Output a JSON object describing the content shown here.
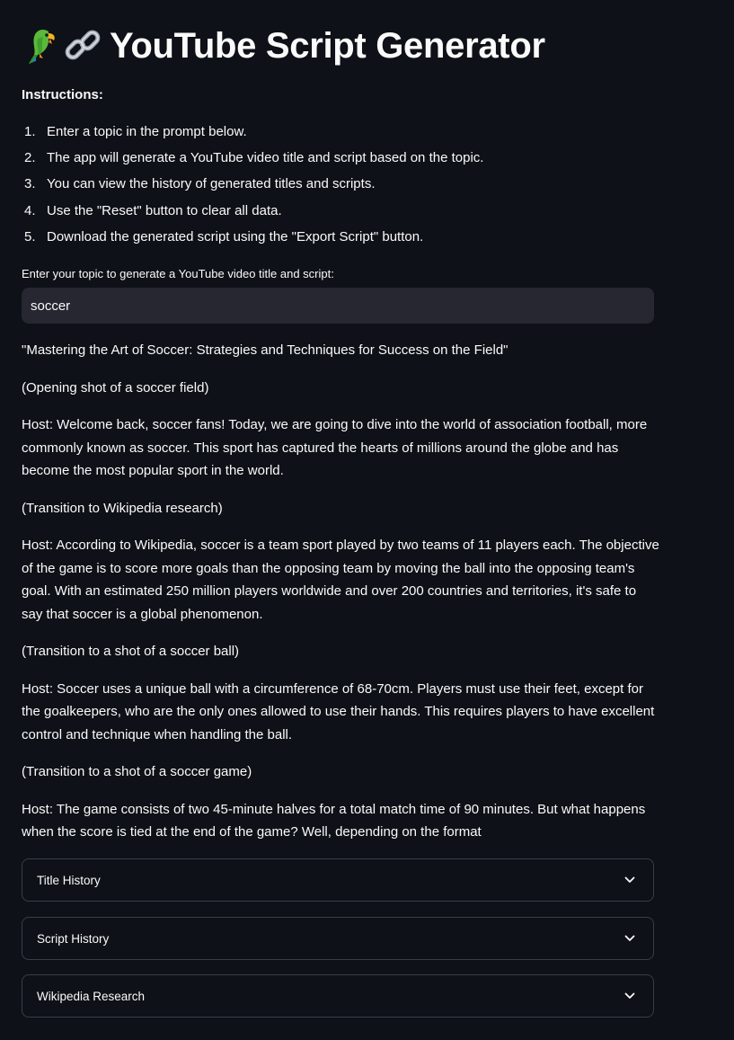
{
  "header": {
    "title": "YouTube Script Generator",
    "icons": [
      "parrot-emoji",
      "link-emoji"
    ]
  },
  "instructions": {
    "label": "Instructions:",
    "steps": [
      {
        "num": "1.",
        "text": "Enter a topic in the prompt below."
      },
      {
        "num": "2.",
        "text": "The app will generate a YouTube video title and script based on the topic."
      },
      {
        "num": "3.",
        "text": "You can view the history of generated titles and scripts."
      },
      {
        "num": "4.",
        "text": "Use the \"Reset\" button to clear all data."
      },
      {
        "num": "5.",
        "text": "Download the generated script using the \"Export Script\" button."
      }
    ]
  },
  "topic_input": {
    "label": "Enter your topic to generate a YouTube video title and script:",
    "value": "soccer"
  },
  "script": {
    "paragraphs": [
      "\"Mastering the Art of Soccer: Strategies and Techniques for Success on the Field\"",
      "(Opening shot of a soccer field)",
      "Host: Welcome back, soccer fans! Today, we are going to dive into the world of association football, more commonly known as soccer. This sport has captured the hearts of millions around the globe and has become the most popular sport in the world.",
      "(Transition to Wikipedia research)",
      "Host: According to Wikipedia, soccer is a team sport played by two teams of 11 players each. The objective of the game is to score more goals than the opposing team by moving the ball into the opposing team's goal. With an estimated 250 million players worldwide and over 200 countries and territories, it's safe to say that soccer is a global phenomenon.",
      "(Transition to a shot of a soccer ball)",
      "Host: Soccer uses a unique ball with a circumference of 68-70cm. Players must use their feet, except for the goalkeepers, who are the only ones allowed to use their hands. This requires players to have excellent control and technique when handling the ball.",
      "(Transition to a shot of a soccer game)",
      "Host: The game consists of two 45-minute halves for a total match time of 90 minutes. But what happens when the score is tied at the end of the game? Well, depending on the format"
    ]
  },
  "expanders": [
    {
      "label": "Title History"
    },
    {
      "label": "Script History"
    },
    {
      "label": "Wikipedia Research"
    }
  ],
  "colors": {
    "background": "#0e1117",
    "input_background": "#262730",
    "text": "#fafafa",
    "border": "#3a3d47"
  }
}
